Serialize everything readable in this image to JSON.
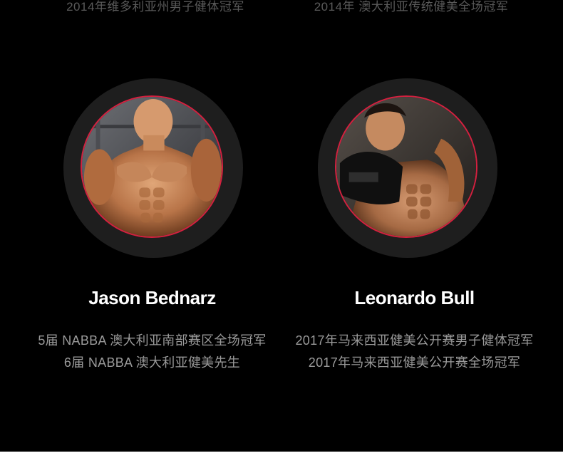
{
  "top_captions": [
    "2014年维多利亚州男子健体冠军",
    "2014年 澳大利亚传统健美全场冠军"
  ],
  "colors": {
    "background": "#000000",
    "ring": "#1e1e1e",
    "accent_border": "#d4203f",
    "name_text": "#ffffff",
    "title_text": "#9a9a9a"
  },
  "athletes": [
    {
      "name": "Jason Bednarz",
      "titles": [
        "5届 NABBA 澳大利亚南部赛区全场冠军",
        "6届 NABBA 澳大利亚健美先生"
      ]
    },
    {
      "name": "Leonardo Bull",
      "titles": [
        "2017年马来西亚健美公开赛男子健体冠军",
        "2017年马来西亚健美公开赛全场冠军"
      ]
    }
  ]
}
